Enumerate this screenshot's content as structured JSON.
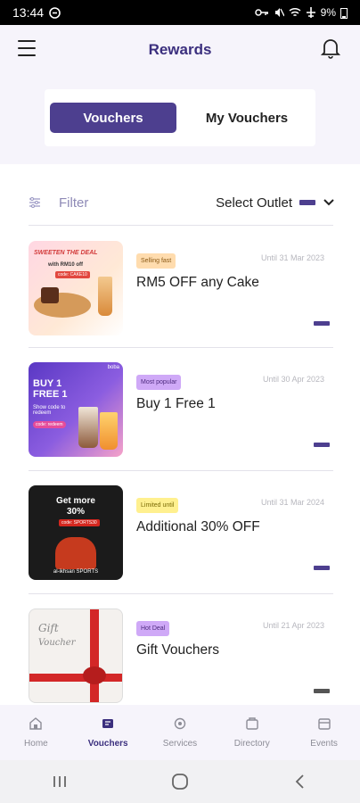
{
  "status": {
    "time": "13:44",
    "battery": "9%"
  },
  "header": {
    "title": "Rewards"
  },
  "tabs": [
    {
      "label": "Vouchers"
    },
    {
      "label": "My Vouchers"
    }
  ],
  "filter": {
    "label": "Filter",
    "outlet_label": "Select Outlet"
  },
  "vouchers": [
    {
      "badge": "Selling fast",
      "badge_color": "#ffdcae",
      "expiry": "Until 31 Mar 2023",
      "title": "RM5 OFF any Cake",
      "thumb": {
        "headline": "SWEETEN THE DEAL",
        "line2": "with RM10 off",
        "code": "code: CAKE10"
      }
    },
    {
      "badge": "Most popular",
      "badge_color": "#cfa9f7",
      "expiry": "Until 30 Apr 2023",
      "title": "Buy 1 Free 1",
      "thumb": {
        "headline": "BUY 1 FREE 1",
        "line2": "Show code to redeem",
        "code": "code: redeem",
        "brand": "boba"
      }
    },
    {
      "badge": "Limited until",
      "badge_color": "#fff08f",
      "expiry": "Until 31 Mar 2024",
      "title": "Additional 30% OFF",
      "thumb": {
        "headline": "Get more",
        "line2": "30%",
        "code": "code: SPORTS30",
        "brand": "al-ikhsan SPORTS"
      }
    },
    {
      "badge": "Hot Deal",
      "badge_color": "#cfa9f7",
      "expiry": "Until 21 Apr 2023",
      "title": "Gift Vouchers",
      "thumb": {
        "headline": "Gift",
        "line2": "Voucher"
      }
    }
  ],
  "nav": [
    {
      "label": "Home"
    },
    {
      "label": "Vouchers"
    },
    {
      "label": "Services"
    },
    {
      "label": "Directory"
    },
    {
      "label": "Events"
    }
  ],
  "colors": {
    "brand": "#4d3f8f",
    "title": "#3b2f7e"
  }
}
